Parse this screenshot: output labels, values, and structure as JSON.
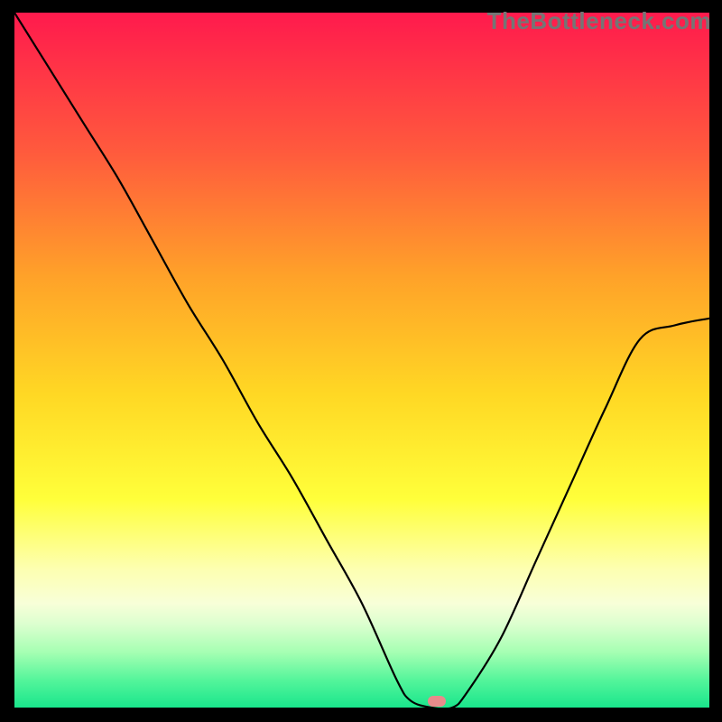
{
  "watermark": "TheBottleneck.com",
  "marker": {
    "x_frac": 0.608,
    "y_frac": 0.006
  },
  "gradient_stops": [
    {
      "offset": 0.0,
      "color": "#ff1a4d"
    },
    {
      "offset": 0.2,
      "color": "#ff5a3d"
    },
    {
      "offset": 0.38,
      "color": "#ffa229"
    },
    {
      "offset": 0.55,
      "color": "#ffd824"
    },
    {
      "offset": 0.7,
      "color": "#ffff3a"
    },
    {
      "offset": 0.8,
      "color": "#fdffb0"
    },
    {
      "offset": 0.85,
      "color": "#f8ffd8"
    },
    {
      "offset": 0.88,
      "color": "#dcffcf"
    },
    {
      "offset": 0.92,
      "color": "#a6ffb3"
    },
    {
      "offset": 0.96,
      "color": "#55f59b"
    },
    {
      "offset": 1.0,
      "color": "#19e68c"
    }
  ],
  "chart_data": {
    "type": "line",
    "title": "",
    "xlabel": "",
    "ylabel": "",
    "ylim": [
      0,
      100
    ],
    "xlim": [
      0,
      100
    ],
    "x": [
      0,
      5,
      10,
      15,
      20,
      25,
      30,
      35,
      40,
      45,
      50,
      55,
      57,
      60,
      63,
      65,
      70,
      75,
      80,
      85,
      90,
      95,
      100
    ],
    "values": [
      100,
      92,
      84,
      76,
      67,
      58,
      50,
      41,
      33,
      24,
      15,
      4,
      1,
      0,
      0,
      2,
      10,
      21,
      32,
      43,
      53,
      55,
      56
    ]
  }
}
